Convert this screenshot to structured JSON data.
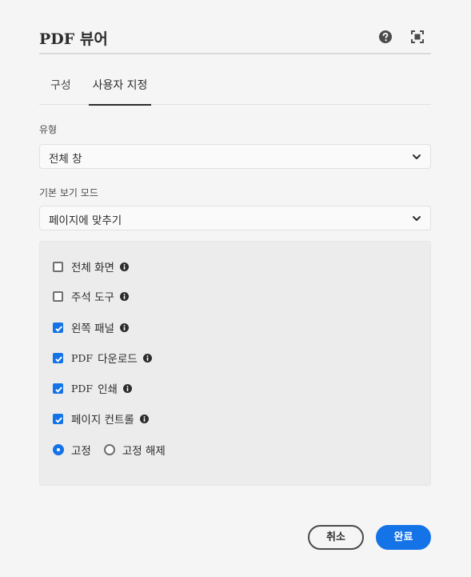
{
  "header": {
    "title_pdf": "PDF",
    "title_text": "뷰어",
    "help_icon": "help-circle-icon",
    "fullscreen_icon": "fullscreen-icon"
  },
  "tabs": [
    {
      "label": "구성",
      "selected": false
    },
    {
      "label": "사용자 지정",
      "selected": true
    }
  ],
  "type_field": {
    "label": "유형",
    "value": "전체 창"
  },
  "view_mode_field": {
    "label": "기본 보기 모드",
    "value": "페이지에 맞추기"
  },
  "options": [
    {
      "label": "전체 화면",
      "prefix": "",
      "checked": false
    },
    {
      "label": "주석 도구",
      "prefix": "",
      "checked": false
    },
    {
      "label": "왼쪽 패널",
      "prefix": "",
      "checked": true
    },
    {
      "label": "다운로드",
      "prefix": "PDF",
      "checked": true
    },
    {
      "label": "인쇄",
      "prefix": "PDF",
      "checked": true
    },
    {
      "label": "페이지 컨트롤",
      "prefix": "",
      "checked": true
    }
  ],
  "dock": {
    "fixed_label": "고정",
    "unfixed_label": "고정 해제",
    "selected": "fixed"
  },
  "footer": {
    "cancel_label": "취소",
    "done_label": "완료"
  },
  "colors": {
    "accent": "#1473e6",
    "background": "#f5f5f5",
    "panel": "#ececec"
  }
}
